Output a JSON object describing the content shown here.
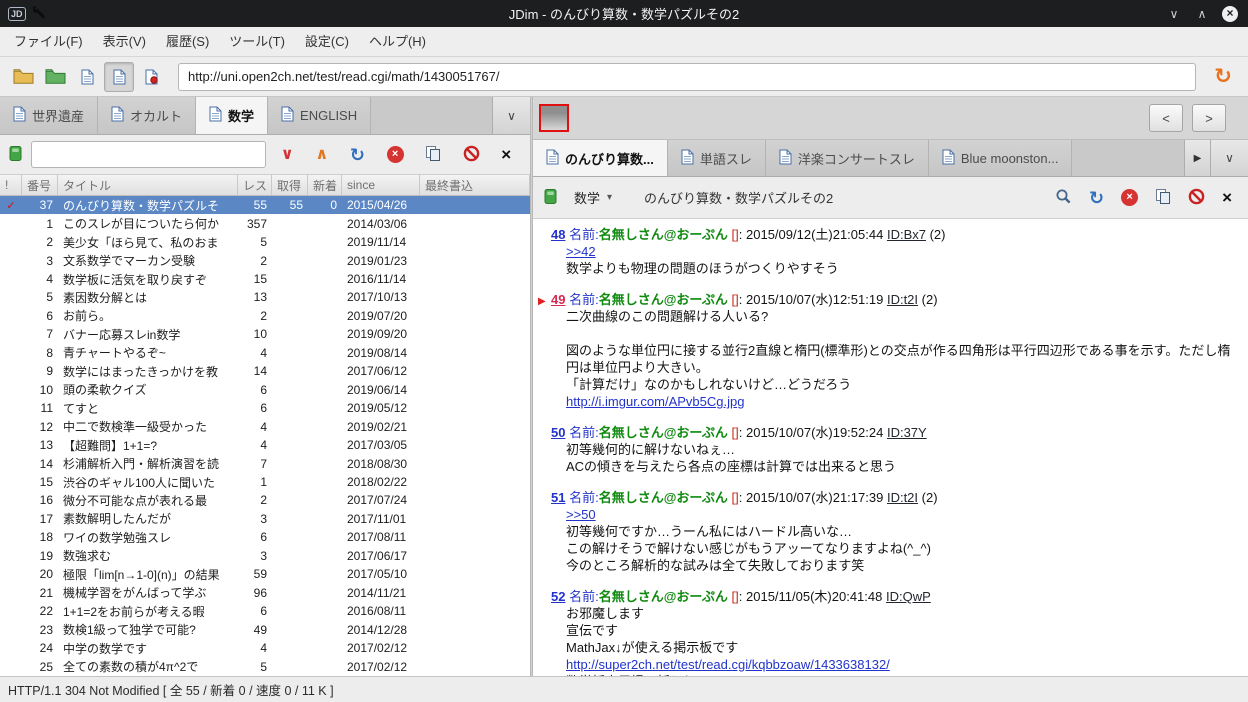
{
  "window": {
    "title": "JDim - のんびり算数・数学パズルその2",
    "controls": {
      "minimize": "∨",
      "maximize": "∧",
      "close": "×"
    }
  },
  "menubar": [
    {
      "label": "ファイル(F)",
      "name": "file"
    },
    {
      "label": "表示(V)",
      "name": "view"
    },
    {
      "label": "履歴(S)",
      "name": "history"
    },
    {
      "label": "ツール(T)",
      "name": "tools"
    },
    {
      "label": "設定(C)",
      "name": "settings"
    },
    {
      "label": "ヘルプ(H)",
      "name": "help"
    }
  ],
  "urlbar": {
    "url": "http://uni.open2ch.net/test/read.cgi/math/1430051767/"
  },
  "icons": {
    "logo_text": "JD",
    "chevron_down": "∨",
    "chevron_down_small": "▾",
    "chevron_up": "∧",
    "close": "×",
    "close_small": "×",
    "refresh": "↻",
    "reload": "↻",
    "play": "▶",
    "check": "✓"
  },
  "colors": {
    "selection": "#5b87c5",
    "link": "#2233cc",
    "new_post": "#d42a55",
    "name_green": "#0f8a0f",
    "mail_red": "#c32b1a",
    "titlebar_bg": "#1d1e20",
    "accent_orange": "#e8721c",
    "stop_red": "#d63333"
  },
  "board_pane": {
    "tabs": [
      {
        "label": "世界遺産",
        "name": "world-heritage",
        "active": false
      },
      {
        "label": "オカルト",
        "name": "occult",
        "active": false
      },
      {
        "label": "数学",
        "name": "math",
        "active": true
      },
      {
        "label": "ENGLISH",
        "name": "english",
        "active": false
      }
    ],
    "search_value": "",
    "columns": [
      {
        "label": "!",
        "key": "mark"
      },
      {
        "label": "番号",
        "key": "num"
      },
      {
        "label": "タイトル",
        "key": "title"
      },
      {
        "label": "レス",
        "key": "res"
      },
      {
        "label": "取得",
        "key": "got"
      },
      {
        "label": "新着",
        "key": "new"
      },
      {
        "label": "since",
        "key": "since"
      },
      {
        "label": "最終書込",
        "key": "last_write"
      }
    ],
    "rows": [
      {
        "mark": "✓",
        "num": "37",
        "title": "のんびり算数・数学パズルそ",
        "res": "55",
        "got": "55",
        "new": "0",
        "since": "2015/04/26",
        "selected": true
      },
      {
        "mark": "",
        "num": "1",
        "title": "このスレが目についたら何か",
        "res": "357",
        "got": "",
        "new": "",
        "since": "2014/03/06",
        "selected": false
      },
      {
        "mark": "",
        "num": "2",
        "title": "美少女「ほら見て、私のおま",
        "res": "5",
        "got": "",
        "new": "",
        "since": "2019/11/14",
        "selected": false
      },
      {
        "mark": "",
        "num": "3",
        "title": "文系数学でマーカン受験",
        "res": "2",
        "got": "",
        "new": "",
        "since": "2019/01/23",
        "selected": false
      },
      {
        "mark": "",
        "num": "4",
        "title": "数学板に活気を取り戻すぞ",
        "res": "15",
        "got": "",
        "new": "",
        "since": "2016/11/14",
        "selected": false
      },
      {
        "mark": "",
        "num": "5",
        "title": "素因数分解とは",
        "res": "13",
        "got": "",
        "new": "",
        "since": "2017/10/13",
        "selected": false
      },
      {
        "mark": "",
        "num": "6",
        "title": "お前ら。",
        "res": "2",
        "got": "",
        "new": "",
        "since": "2019/07/20",
        "selected": false
      },
      {
        "mark": "",
        "num": "7",
        "title": "バナー応募スレin数学",
        "res": "10",
        "got": "",
        "new": "",
        "since": "2019/09/20",
        "selected": false
      },
      {
        "mark": "",
        "num": "8",
        "title": "青チャートやるぞ~",
        "res": "4",
        "got": "",
        "new": "",
        "since": "2019/08/14",
        "selected": false
      },
      {
        "mark": "",
        "num": "9",
        "title": "数学にはまったきっかけを教",
        "res": "14",
        "got": "",
        "new": "",
        "since": "2017/06/12",
        "selected": false
      },
      {
        "mark": "",
        "num": "10",
        "title": "頭の柔軟クイズ",
        "res": "6",
        "got": "",
        "new": "",
        "since": "2019/06/14",
        "selected": false
      },
      {
        "mark": "",
        "num": "11",
        "title": "てすと",
        "res": "6",
        "got": "",
        "new": "",
        "since": "2019/05/12",
        "selected": false
      },
      {
        "mark": "",
        "num": "12",
        "title": "中二で数検準一級受かった",
        "res": "4",
        "got": "",
        "new": "",
        "since": "2019/02/21",
        "selected": false
      },
      {
        "mark": "",
        "num": "13",
        "title": "【超難問】1+1=?",
        "res": "4",
        "got": "",
        "new": "",
        "since": "2017/03/05",
        "selected": false
      },
      {
        "mark": "",
        "num": "14",
        "title": "杉浦解析入門・解析演習を読",
        "res": "7",
        "got": "",
        "new": "",
        "since": "2018/08/30",
        "selected": false
      },
      {
        "mark": "",
        "num": "15",
        "title": "渋谷のギャル100人に聞いた",
        "res": "1",
        "got": "",
        "new": "",
        "since": "2018/02/22",
        "selected": false
      },
      {
        "mark": "",
        "num": "16",
        "title": "微分不可能な点が表れる最",
        "res": "2",
        "got": "",
        "new": "",
        "since": "2017/07/24",
        "selected": false
      },
      {
        "mark": "",
        "num": "17",
        "title": "素数解明したんだが",
        "res": "3",
        "got": "",
        "new": "",
        "since": "2017/11/01",
        "selected": false
      },
      {
        "mark": "",
        "num": "18",
        "title": "ワイの数学勉強スレ",
        "res": "6",
        "got": "",
        "new": "",
        "since": "2017/08/11",
        "selected": false
      },
      {
        "mark": "",
        "num": "19",
        "title": "数強求む",
        "res": "3",
        "got": "",
        "new": "",
        "since": "2017/06/17",
        "selected": false
      },
      {
        "mark": "",
        "num": "20",
        "title": "極限「lim[n→1-0](n)」の結果",
        "res": "59",
        "got": "",
        "new": "",
        "since": "2017/05/10",
        "selected": false
      },
      {
        "mark": "",
        "num": "21",
        "title": "機械学習をがんばって学ぶ",
        "res": "96",
        "got": "",
        "new": "",
        "since": "2014/11/21",
        "selected": false
      },
      {
        "mark": "",
        "num": "22",
        "title": "1+1=2をお前らが考える暇",
        "res": "6",
        "got": "",
        "new": "",
        "since": "2016/08/11",
        "selected": false
      },
      {
        "mark": "",
        "num": "23",
        "title": "数検1級って独学で可能?",
        "res": "49",
        "got": "",
        "new": "",
        "since": "2014/12/28",
        "selected": false
      },
      {
        "mark": "",
        "num": "24",
        "title": "中学の数学です",
        "res": "4",
        "got": "",
        "new": "",
        "since": "2017/02/12",
        "selected": false
      },
      {
        "mark": "",
        "num": "25",
        "title": "全ての素数の積が4π^2で",
        "res": "5",
        "got": "",
        "new": "",
        "since": "2017/02/12",
        "selected": false
      }
    ]
  },
  "thread_pane": {
    "nav": {
      "prev": "<",
      "next": ">"
    },
    "tabs": [
      {
        "label": "のんびり算数...",
        "name": "nonbiri-sansu",
        "active": true
      },
      {
        "label": "単語スレ",
        "name": "tango-sure",
        "active": false
      },
      {
        "label": "洋楽コンサートスレ",
        "name": "yogaku-concert-sure",
        "active": false
      },
      {
        "label": "Blue moonston...",
        "name": "blue-moonstone",
        "active": false
      }
    ],
    "board_select": "数学",
    "title": "のんびり算数・数学パズルその2",
    "labels": {
      "name_label": "名前:",
      "colon": ":"
    },
    "posts": [
      {
        "num": "48",
        "num_style": "read",
        "marker": false,
        "name": "名無しさん@おーぷん",
        "mail": "[]",
        "date": "2015/09/12(土)21:05:44",
        "id": "ID:Bx7",
        "count": "(2)",
        "lines": [
          {
            "type": "anchor",
            "text": ">>42"
          },
          {
            "type": "text",
            "text": "数学よりも物理の問題のほうがつくりやすそう"
          }
        ]
      },
      {
        "num": "49",
        "num_style": "new",
        "marker": true,
        "name": "名無しさん@おーぷん",
        "mail": "[]",
        "date": "2015/10/07(水)12:51:19",
        "id": "ID:t2I",
        "count": "(2)",
        "lines": [
          {
            "type": "text",
            "text": "二次曲線のこの問題解ける人いる?"
          },
          {
            "type": "blank",
            "text": ""
          },
          {
            "type": "text",
            "text": "図のような単位円に接する並行2直線と楕円(標準形)との交点が作る四角形は平行四辺形である事を示す。ただし楕円は単位円より大きい。"
          },
          {
            "type": "text",
            "text": "「計算だけ」なのかもしれないけど…どうだろう"
          },
          {
            "type": "link",
            "text": "http://i.imgur.com/APvb5Cg.jpg"
          }
        ]
      },
      {
        "num": "50",
        "num_style": "read",
        "marker": false,
        "name": "名無しさん@おーぷん",
        "mail": "[]",
        "date": "2015/10/07(水)19:52:24",
        "id": "ID:37Y",
        "count": "",
        "lines": [
          {
            "type": "text",
            "text": "初等幾何的に解けないねぇ…"
          },
          {
            "type": "text",
            "text": "ACの傾きを与えたら各点の座標は計算では出来ると思う"
          }
        ]
      },
      {
        "num": "51",
        "num_style": "read",
        "marker": false,
        "name": "名無しさん@おーぷん",
        "mail": "[]",
        "date": "2015/10/07(水)21:17:39",
        "id": "ID:t2I",
        "count": "(2)",
        "lines": [
          {
            "type": "anchor",
            "text": ">>50"
          },
          {
            "type": "text",
            "text": "初等幾何ですか…うーん私にはハードル高いな…"
          },
          {
            "type": "text",
            "text": "この解けそうで解けない感じがもうアッーてなりますよね(^_^)"
          },
          {
            "type": "text",
            "text": "今のところ解析的な試みは全て失敗しております笑"
          }
        ]
      },
      {
        "num": "52",
        "num_style": "read",
        "marker": false,
        "name": "名無しさん@おーぷん",
        "mail": "[]",
        "date": "2015/11/05(木)20:41:48",
        "id": "ID:QwP",
        "count": "",
        "lines": [
          {
            "type": "text",
            "text": "お邪魔します"
          },
          {
            "type": "text",
            "text": "宣伝です"
          },
          {
            "type": "text",
            "text": "MathJax↓が使える掲示板です"
          },
          {
            "type": "link",
            "text": "http://super2ch.net/test/read.cgi/kqbbzoaw/1433638132/"
          },
          {
            "type": "text",
            "text": "数学板専用掲示板として～"
          }
        ]
      }
    ]
  },
  "statusbar": {
    "text": "HTTP/1.1 304 Not Modified [ 全 55 / 新着 0 / 速度 0 / 11 K ]"
  }
}
